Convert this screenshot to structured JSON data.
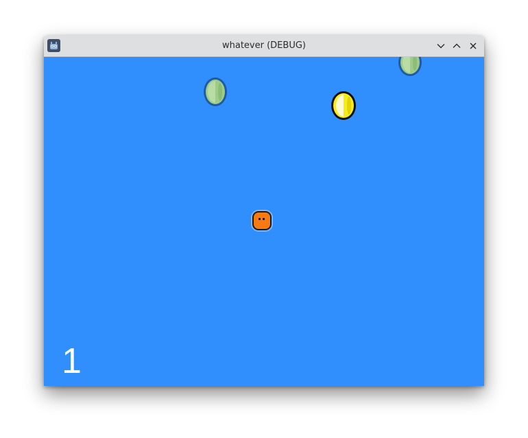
{
  "window": {
    "title": "whatever (DEBUG)"
  },
  "titlebar_buttons": {
    "minimize": "chevron-down-icon",
    "maximize": "chevron-up-icon",
    "close": "close-icon"
  },
  "game": {
    "background_color": "#308ffc",
    "score": "1",
    "entities": {
      "player": "orange-blob",
      "coin": "yellow-coin",
      "faded_coins": [
        "green-coin",
        "green-coin"
      ]
    }
  },
  "colors": {
    "titlebar": "#dedfe0",
    "coin_yellow": "#f6ec18",
    "coin_green": "#9ecb88",
    "player_orange": "#f57a14"
  }
}
